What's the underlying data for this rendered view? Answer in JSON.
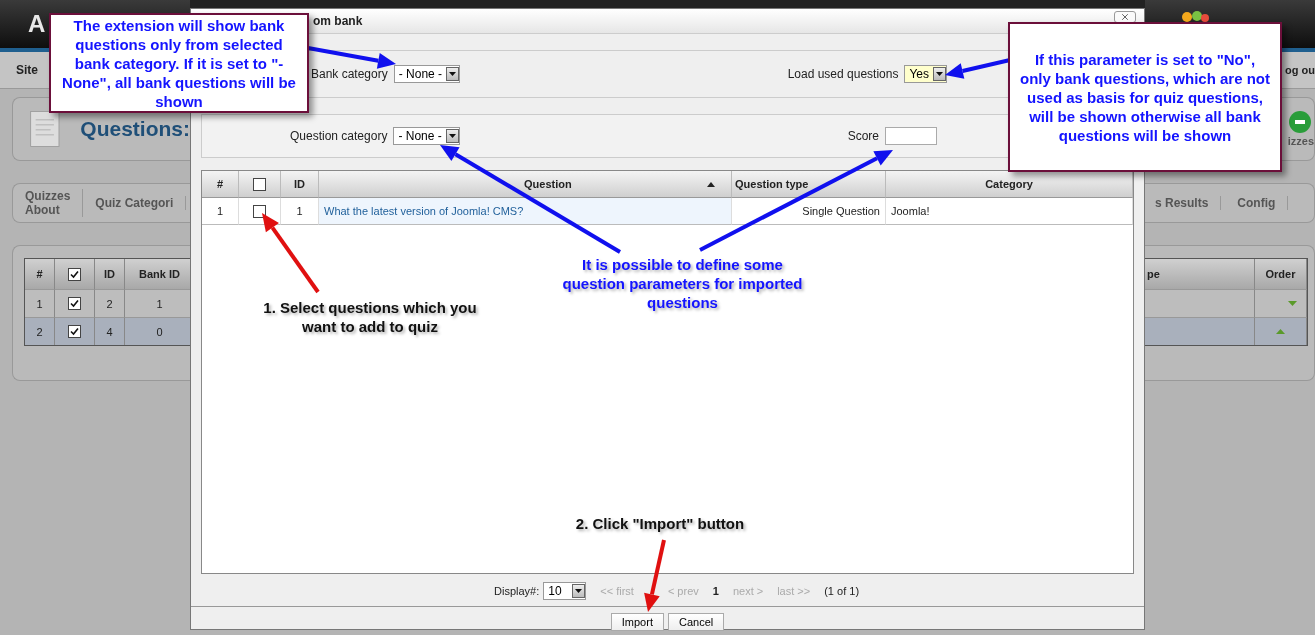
{
  "page": {
    "header_text": "A",
    "menu_left": "Site",
    "menu_right": "og ou",
    "heading": "Questions:",
    "toolbar_label": "izzes",
    "tabs_left": [
      {
        "lines": [
          "Quizzes",
          "About"
        ]
      },
      {
        "lines": [
          "Quiz Categori"
        ]
      }
    ],
    "tabs_right": [
      "s Results",
      "Config"
    ],
    "table_left": {
      "columns": [
        {
          "kind": "text",
          "label": "#"
        },
        {
          "kind": "checkbox",
          "checked": true
        },
        {
          "kind": "text",
          "label": "ID"
        },
        {
          "kind": "text",
          "label": "Bank ID"
        }
      ],
      "rows": [
        {
          "num": "1",
          "checked": true,
          "id": "2",
          "bank_id": "1"
        },
        {
          "num": "2",
          "checked": true,
          "id": "4",
          "bank_id": "0"
        }
      ]
    },
    "table_right": {
      "columns": [
        "pe",
        "Order"
      ],
      "rows": [
        {
          "kind": "down"
        },
        {
          "kind": "up"
        }
      ]
    }
  },
  "modal": {
    "title": "om bank",
    "bank_category": {
      "label": "Bank category",
      "value": "- None -"
    },
    "load_used": {
      "label": "Load used questions",
      "value": "Yes"
    },
    "question_category": {
      "label": "Question category",
      "value": "- None -"
    },
    "score": {
      "label": "Score"
    },
    "table": {
      "columns": [
        {
          "kind": "text",
          "label": "#"
        },
        {
          "kind": "checkbox",
          "checked": false
        },
        {
          "kind": "text",
          "label": "ID"
        },
        {
          "kind": "text",
          "label": "Question",
          "sorted": true
        },
        {
          "kind": "text",
          "label": "Question type"
        },
        {
          "kind": "text",
          "label": "Category"
        }
      ],
      "rows": [
        {
          "num": "1",
          "checked": false,
          "id": "1",
          "question": "What the latest version of Joomla! CMS?",
          "type": "Single Question",
          "category": "Joomla!"
        }
      ]
    },
    "pagination": {
      "label": "Display#:",
      "per_page": "10",
      "first": "<< first",
      "prev": "< prev",
      "page": "1",
      "next": "next >",
      "last": "last >>",
      "summary": "(1 of 1)"
    },
    "buttons": [
      "Import",
      "Cancel"
    ]
  },
  "annotations": [
    {
      "kind": "callout",
      "text": "The extension will show bank questions only from selected bank category. If it is set to \"- None\", all bank questions will be shown"
    },
    {
      "kind": "callout",
      "text": "If this parameter is set to \"No\", only bank questions, which are not used as basis for quiz questions, will be shown otherwise all bank questions will be shown"
    },
    {
      "kind": "hint",
      "text": "It is possible to define some question parameters for imported questions"
    },
    {
      "kind": "step",
      "text": "1. Select questions which you want to add to quiz"
    },
    {
      "kind": "step",
      "text": "2. Click \"Import\" button"
    }
  ]
}
